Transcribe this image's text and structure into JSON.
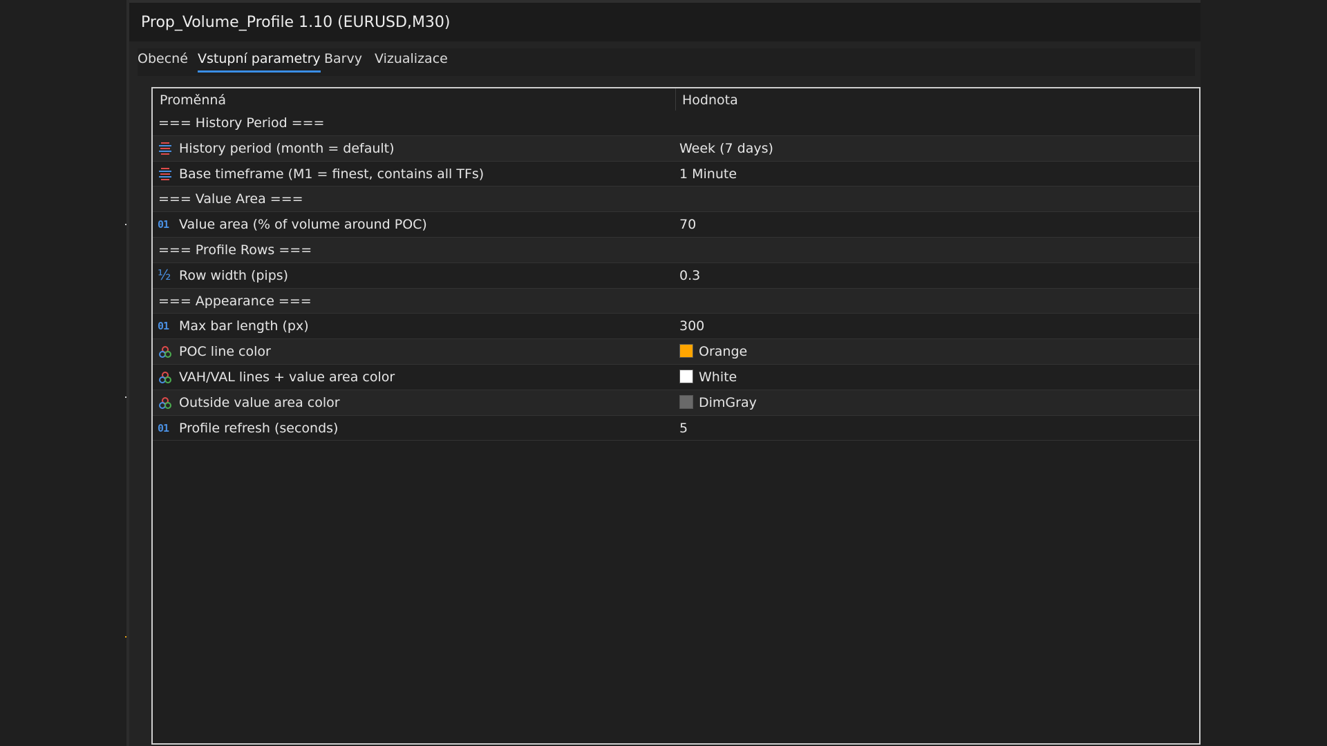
{
  "window": {
    "title": "Prop_Volume_Profile 1.10 (EURUSD,M30)"
  },
  "tabs": [
    {
      "label": "Obecné",
      "active": false
    },
    {
      "label": "Vstupní parametry",
      "active": true
    },
    {
      "label": "Barvy",
      "active": false
    },
    {
      "label": "Vizualizace",
      "active": false
    }
  ],
  "table": {
    "headers": {
      "name": "Proměnná",
      "value": "Hodnota"
    },
    "rows": [
      {
        "type": "section",
        "name": "=== History Period ===",
        "value": ""
      },
      {
        "type": "enum",
        "icon": "enum-list-icon",
        "name": "History period (month = default)",
        "value": "Week (7 days)"
      },
      {
        "type": "enum",
        "icon": "enum-list-icon",
        "name": "Base timeframe (M1 = finest, contains all TFs)",
        "value": "1 Minute"
      },
      {
        "type": "section",
        "name": "=== Value Area ===",
        "value": ""
      },
      {
        "type": "int",
        "icon": "integer-icon",
        "name": "Value area (% of volume around POC)",
        "value": "70"
      },
      {
        "type": "section",
        "name": "=== Profile Rows ===",
        "value": ""
      },
      {
        "type": "double",
        "icon": "fraction-icon",
        "name": "Row width (pips)",
        "value": "0.3"
      },
      {
        "type": "section",
        "name": "=== Appearance ===",
        "value": ""
      },
      {
        "type": "int",
        "icon": "integer-icon",
        "name": "Max bar length (px)",
        "value": "300"
      },
      {
        "type": "color",
        "icon": "color-icon",
        "name": "POC line color",
        "value": "Orange",
        "swatch": "#FFA500"
      },
      {
        "type": "color",
        "icon": "color-icon",
        "name": "VAH/VAL lines + value area color",
        "value": "White",
        "swatch": "#FFFFFF"
      },
      {
        "type": "color",
        "icon": "color-icon",
        "name": "Outside value area color",
        "value": "DimGray",
        "swatch": "#696969"
      },
      {
        "type": "int",
        "icon": "integer-icon",
        "name": "Profile refresh (seconds)",
        "value": "5"
      }
    ]
  },
  "colors": {
    "accent": "#3a8ee6",
    "icon_blue": "#4a90e2",
    "icon_red": "#e04b4b"
  },
  "icon_labels": {
    "integer": "01",
    "fraction": "½"
  }
}
